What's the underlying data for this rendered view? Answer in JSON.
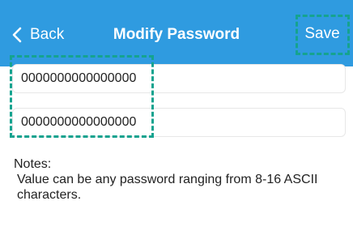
{
  "header": {
    "back_label": "Back",
    "title": "Modify Password",
    "save_label": "Save"
  },
  "fields": {
    "password": "0000000000000000",
    "confirm_password": "0000000000000000"
  },
  "notes": {
    "heading": "Notes:",
    "body": "Value can be any password ranging from 8-16 ASCII characters."
  },
  "colors": {
    "header_bg": "#2f9be0",
    "highlight": "#15a38f"
  }
}
